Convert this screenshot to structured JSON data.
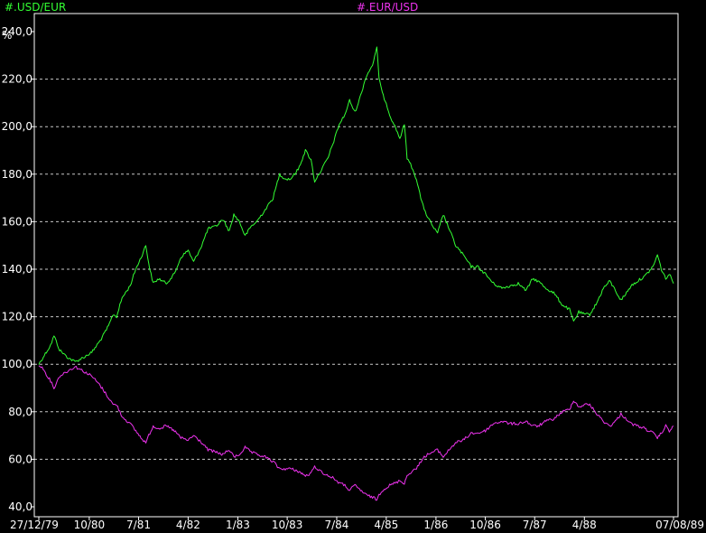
{
  "chart_data": {
    "type": "line",
    "x_unit": "date",
    "y_unit": "%",
    "ylim": [
      40,
      240
    ],
    "yticks": [
      40,
      60,
      80,
      100,
      120,
      140,
      160,
      180,
      200,
      220,
      240
    ],
    "ytick_labels": [
      "40,0",
      "60,0",
      "80,0",
      "100,0",
      "120,0",
      "140,0",
      "160,0",
      "180,0",
      "200,0",
      "220,0",
      "240,0"
    ],
    "xticks": [
      {
        "date": "1979-12-27",
        "label": "27/12/79"
      },
      {
        "date": "1980-10-01",
        "label": "10/80"
      },
      {
        "date": "1981-07-01",
        "label": "7/81"
      },
      {
        "date": "1982-04-01",
        "label": "4/82"
      },
      {
        "date": "1983-01-01",
        "label": "1/83"
      },
      {
        "date": "1983-10-01",
        "label": "10/83"
      },
      {
        "date": "1984-07-01",
        "label": "7/84"
      },
      {
        "date": "1985-04-01",
        "label": "4/85"
      },
      {
        "date": "1986-01-01",
        "label": "1/86"
      },
      {
        "date": "1986-10-01",
        "label": "10/86"
      },
      {
        "date": "1987-07-01",
        "label": "7/87"
      },
      {
        "date": "1988-04-01",
        "label": "4/88"
      },
      {
        "date": "1989-08-07",
        "label": "07/08/89"
      }
    ],
    "grid": true,
    "legend": "top",
    "series": [
      {
        "name": "#.USD/EUR",
        "color": "#33ff33",
        "points": [
          [
            "1979-12-27",
            100
          ],
          [
            "1980-01-20",
            103
          ],
          [
            "1980-03-01",
            108
          ],
          [
            "1980-03-20",
            112
          ],
          [
            "1980-04-20",
            106
          ],
          [
            "1980-06-01",
            103
          ],
          [
            "1980-07-15",
            101
          ],
          [
            "1980-09-01",
            103
          ],
          [
            "1980-10-15",
            105
          ],
          [
            "1980-12-01",
            110
          ],
          [
            "1981-01-15",
            116
          ],
          [
            "1981-02-10",
            121
          ],
          [
            "1981-03-01",
            120
          ],
          [
            "1981-04-01",
            128
          ],
          [
            "1981-05-15",
            133
          ],
          [
            "1981-06-15",
            140
          ],
          [
            "1981-07-15",
            145
          ],
          [
            "1981-08-10",
            150
          ],
          [
            "1981-09-01",
            140
          ],
          [
            "1981-09-20",
            134
          ],
          [
            "1981-10-20",
            136
          ],
          [
            "1981-12-01",
            134
          ],
          [
            "1982-01-15",
            138
          ],
          [
            "1982-02-20",
            145
          ],
          [
            "1982-04-01",
            148
          ],
          [
            "1982-05-01",
            143
          ],
          [
            "1982-06-15",
            150
          ],
          [
            "1982-07-20",
            157
          ],
          [
            "1982-09-01",
            158
          ],
          [
            "1982-10-10",
            161
          ],
          [
            "1982-11-15",
            156
          ],
          [
            "1982-12-10",
            163
          ],
          [
            "1983-01-10",
            160
          ],
          [
            "1983-02-10",
            154
          ],
          [
            "1983-03-15",
            158
          ],
          [
            "1983-04-15",
            160
          ],
          [
            "1983-06-01",
            165
          ],
          [
            "1983-07-15",
            170
          ],
          [
            "1983-08-20",
            180
          ],
          [
            "1983-09-20",
            178
          ],
          [
            "1983-10-20",
            178
          ],
          [
            "1983-12-01",
            182
          ],
          [
            "1984-01-10",
            190
          ],
          [
            "1984-02-10",
            186
          ],
          [
            "1984-03-01",
            177
          ],
          [
            "1984-04-01",
            181
          ],
          [
            "1984-05-15",
            187
          ],
          [
            "1984-06-15",
            194
          ],
          [
            "1984-07-15",
            201
          ],
          [
            "1984-08-15",
            205
          ],
          [
            "1984-09-10",
            211
          ],
          [
            "1984-10-10",
            206
          ],
          [
            "1984-11-10",
            213
          ],
          [
            "1984-12-10",
            221
          ],
          [
            "1985-01-15",
            226
          ],
          [
            "1985-02-08",
            233
          ],
          [
            "1985-02-20",
            221
          ],
          [
            "1985-03-10",
            214
          ],
          [
            "1985-04-01",
            210
          ],
          [
            "1985-04-20",
            205
          ],
          [
            "1985-05-20",
            200
          ],
          [
            "1985-06-15",
            195
          ],
          [
            "1985-07-10",
            201
          ],
          [
            "1985-07-25",
            187
          ],
          [
            "1985-08-20",
            183
          ],
          [
            "1985-09-15",
            178
          ],
          [
            "1985-10-15",
            168
          ],
          [
            "1985-11-15",
            162
          ],
          [
            "1985-12-15",
            158
          ],
          [
            "1986-01-10",
            155
          ],
          [
            "1986-02-10",
            163
          ],
          [
            "1986-03-15",
            157
          ],
          [
            "1986-04-20",
            150
          ],
          [
            "1986-06-01",
            146
          ],
          [
            "1986-07-15",
            141
          ],
          [
            "1986-08-20",
            141
          ],
          [
            "1986-10-01",
            138
          ],
          [
            "1986-11-15",
            134
          ],
          [
            "1987-01-01",
            132
          ],
          [
            "1987-02-15",
            133
          ],
          [
            "1987-04-01",
            134
          ],
          [
            "1987-05-15",
            131
          ],
          [
            "1987-06-20",
            136
          ],
          [
            "1987-07-20",
            135
          ],
          [
            "1987-09-01",
            132
          ],
          [
            "1987-10-15",
            130
          ],
          [
            "1987-12-01",
            125
          ],
          [
            "1988-01-10",
            123
          ],
          [
            "1988-02-01",
            118
          ],
          [
            "1988-03-01",
            122
          ],
          [
            "1988-04-01",
            121
          ],
          [
            "1988-05-01",
            121
          ],
          [
            "1988-06-10",
            126
          ],
          [
            "1988-07-15",
            132
          ],
          [
            "1988-08-20",
            135
          ],
          [
            "1988-09-20",
            131
          ],
          [
            "1988-10-20",
            127
          ],
          [
            "1988-11-20",
            130
          ],
          [
            "1988-12-15",
            133
          ],
          [
            "1989-01-20",
            135
          ],
          [
            "1989-03-01",
            137
          ],
          [
            "1989-04-15",
            141
          ],
          [
            "1989-05-10",
            146
          ],
          [
            "1989-06-01",
            140
          ],
          [
            "1989-06-25",
            136
          ],
          [
            "1989-07-15",
            138
          ],
          [
            "1989-08-07",
            134
          ]
        ]
      },
      {
        "name": "#.EUR/USD",
        "color": "#ee33ee",
        "points": [
          [
            "1979-12-27",
            100
          ],
          [
            "1980-01-20",
            98
          ],
          [
            "1980-03-01",
            93
          ],
          [
            "1980-03-20",
            90
          ],
          [
            "1980-04-20",
            95
          ],
          [
            "1980-06-01",
            97
          ],
          [
            "1980-07-15",
            99
          ],
          [
            "1980-09-01",
            97
          ],
          [
            "1980-10-15",
            95
          ],
          [
            "1980-12-01",
            91
          ],
          [
            "1981-01-15",
            86
          ],
          [
            "1981-02-10",
            83
          ],
          [
            "1981-03-01",
            83
          ],
          [
            "1981-04-01",
            78
          ],
          [
            "1981-05-15",
            75
          ],
          [
            "1981-06-15",
            72
          ],
          [
            "1981-07-15",
            69
          ],
          [
            "1981-08-10",
            67
          ],
          [
            "1981-09-01",
            71
          ],
          [
            "1981-09-20",
            74
          ],
          [
            "1981-10-20",
            73
          ],
          [
            "1981-12-01",
            74
          ],
          [
            "1982-01-15",
            72
          ],
          [
            "1982-02-20",
            69
          ],
          [
            "1982-04-01",
            68
          ],
          [
            "1982-05-01",
            70
          ],
          [
            "1982-06-15",
            67
          ],
          [
            "1982-07-20",
            64
          ],
          [
            "1982-09-01",
            63
          ],
          [
            "1982-10-10",
            62
          ],
          [
            "1982-11-15",
            64
          ],
          [
            "1982-12-10",
            61
          ],
          [
            "1983-01-10",
            62
          ],
          [
            "1983-02-10",
            65
          ],
          [
            "1983-03-15",
            63
          ],
          [
            "1983-04-15",
            62
          ],
          [
            "1983-06-01",
            61
          ],
          [
            "1983-07-15",
            59
          ],
          [
            "1983-08-20",
            56
          ],
          [
            "1983-09-20",
            56
          ],
          [
            "1983-10-20",
            56
          ],
          [
            "1983-12-01",
            55
          ],
          [
            "1984-01-10",
            53
          ],
          [
            "1984-02-10",
            54
          ],
          [
            "1984-03-01",
            57
          ],
          [
            "1984-04-01",
            55
          ],
          [
            "1984-05-15",
            53
          ],
          [
            "1984-06-15",
            52
          ],
          [
            "1984-07-15",
            50
          ],
          [
            "1984-08-15",
            49
          ],
          [
            "1984-09-10",
            47
          ],
          [
            "1984-10-10",
            49
          ],
          [
            "1984-11-10",
            47
          ],
          [
            "1984-12-10",
            45
          ],
          [
            "1985-01-15",
            44
          ],
          [
            "1985-02-08",
            43
          ],
          [
            "1985-02-20",
            45
          ],
          [
            "1985-03-10",
            47
          ],
          [
            "1985-04-01",
            48
          ],
          [
            "1985-04-20",
            49
          ],
          [
            "1985-05-20",
            50
          ],
          [
            "1985-06-15",
            51
          ],
          [
            "1985-07-10",
            50
          ],
          [
            "1985-07-25",
            53
          ],
          [
            "1985-08-20",
            55
          ],
          [
            "1985-09-15",
            56
          ],
          [
            "1985-10-15",
            60
          ],
          [
            "1985-11-15",
            62
          ],
          [
            "1985-12-15",
            63
          ],
          [
            "1986-01-10",
            64
          ],
          [
            "1986-02-10",
            61
          ],
          [
            "1986-03-15",
            64
          ],
          [
            "1986-04-20",
            67
          ],
          [
            "1986-06-01",
            68
          ],
          [
            "1986-07-15",
            71
          ],
          [
            "1986-08-20",
            71
          ],
          [
            "1986-10-01",
            72
          ],
          [
            "1986-11-15",
            75
          ],
          [
            "1987-01-01",
            76
          ],
          [
            "1987-02-15",
            75
          ],
          [
            "1987-04-01",
            75
          ],
          [
            "1987-05-15",
            76
          ],
          [
            "1987-06-20",
            74
          ],
          [
            "1987-07-20",
            74
          ],
          [
            "1987-09-01",
            76
          ],
          [
            "1987-10-15",
            77
          ],
          [
            "1987-12-01",
            80
          ],
          [
            "1988-01-10",
            81
          ],
          [
            "1988-02-01",
            85
          ],
          [
            "1988-03-01",
            82
          ],
          [
            "1988-04-01",
            83
          ],
          [
            "1988-05-01",
            83
          ],
          [
            "1988-06-10",
            79
          ],
          [
            "1988-07-15",
            76
          ],
          [
            "1988-08-20",
            74
          ],
          [
            "1988-09-20",
            76
          ],
          [
            "1988-10-20",
            79
          ],
          [
            "1988-11-20",
            77
          ],
          [
            "1988-12-15",
            75
          ],
          [
            "1989-01-20",
            74
          ],
          [
            "1989-03-01",
            73
          ],
          [
            "1989-04-15",
            71
          ],
          [
            "1989-05-10",
            69
          ],
          [
            "1989-06-01",
            71
          ],
          [
            "1989-06-25",
            74
          ],
          [
            "1989-07-15",
            72
          ],
          [
            "1989-08-07",
            74
          ]
        ]
      }
    ]
  }
}
